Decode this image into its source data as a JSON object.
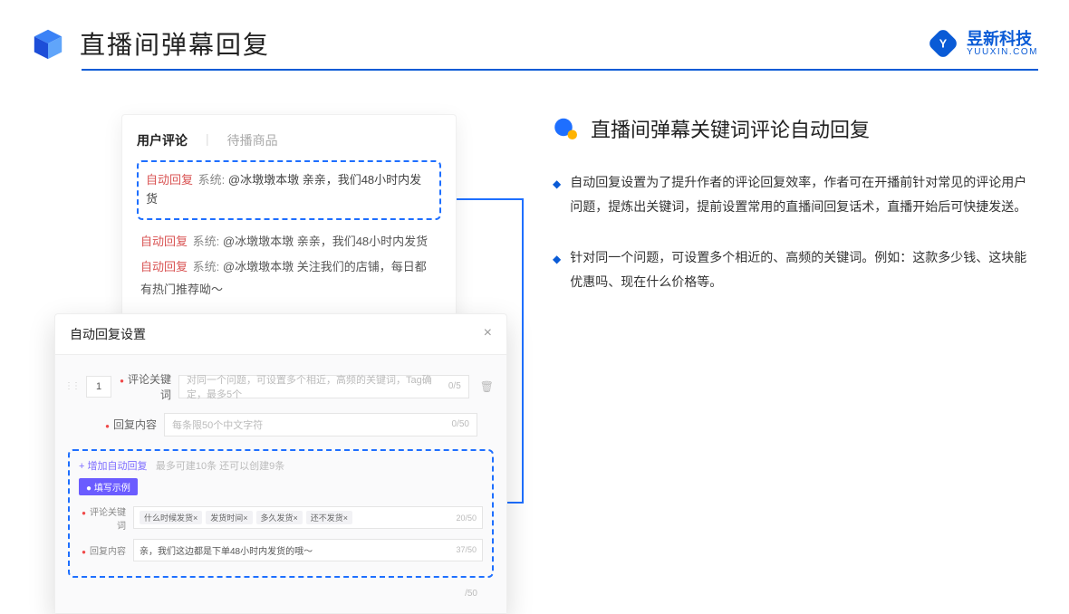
{
  "header": {
    "title": "直播间弹幕回复",
    "brand_name": "昱新科技",
    "brand_url": "YUUXIN.COM"
  },
  "comment_card": {
    "tab_active": "用户评论",
    "tab_inactive": "待播商品",
    "highlight_prefix": "自动回复",
    "highlight_sys": "系统:",
    "highlight_body": "@冰墩墩本墩 亲亲，我们48小时内发货",
    "line2_prefix": "自动回复",
    "line2_sys": "系统:",
    "line2_body": "@冰墩墩本墩 亲亲，我们48小时内发货",
    "line3_prefix": "自动回复",
    "line3_sys": "系统:",
    "line3_body": "@冰墩墩本墩 关注我们的店铺，每日都有热门推荐呦～"
  },
  "modal": {
    "title": "自动回复设置",
    "idx": "1",
    "label_keyword": "评论关键词",
    "placeholder_keyword": "对同一个问题，可设置多个相近，高频的关键词，Tag确定，最多5个",
    "count_keyword": "0/5",
    "label_content": "回复内容",
    "placeholder_content": "每条限50个中文字符",
    "count_content": "0/50",
    "add_link": "+ 增加自动回复",
    "add_hint": "最多可建10条 还可以创建9条",
    "example_pill": "● 填写示例",
    "ex_label_kw": "评论关键词",
    "ex_tags": [
      "什么时候发货×",
      "发货时间×",
      "多久发货×",
      "还不发货×"
    ],
    "ex_count_kw": "20/50",
    "ex_label_ct": "回复内容",
    "ex_content_text": "亲，我们这边都是下单48小时内发货的哦～",
    "ex_count_ct": "37/50",
    "trailing_count": "/50"
  },
  "right": {
    "title": "直播间弹幕关键词评论自动回复",
    "bullets": [
      "自动回复设置为了提升作者的评论回复效率，作者可在开播前针对常见的评论用户问题，提炼出关键词，提前设置常用的直播间回复话术，直播开始后可快捷发送。",
      "针对同一个问题，可设置多个相近的、高频的关键词。例如：这款多少钱、这块能优惠吗、现在什么价格等。"
    ]
  }
}
